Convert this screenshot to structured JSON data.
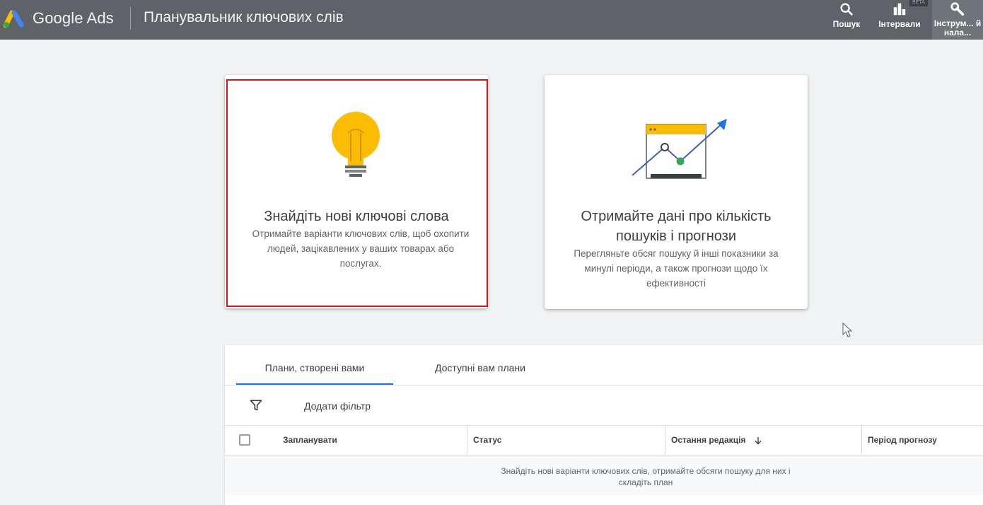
{
  "header": {
    "brand": "Google Ads",
    "title": "Планувальник ключових слів",
    "tools": {
      "search": "Пошук",
      "intervals": "Інтервали",
      "intervals_badge": "BETA",
      "settings": "Інструм... й нала..."
    }
  },
  "cards": {
    "find": {
      "title": "Знайдіть нові ключові слова",
      "description": "Отримайте варіанти ключових слів, щоб охопити людей, зацікавлених у ваших товарах або послугах."
    },
    "forecast": {
      "title": "Отримайте дані про кількість пошуків і прогнози",
      "description": "Перегляньте обсяг пошуку й інші показники за минулі періоди, а також прогнози щодо їх ефективності"
    }
  },
  "plans": {
    "tabs": [
      "Плани, створені вами",
      "Доступні вам плани"
    ],
    "add_filter": "Додати фільтр",
    "columns": [
      "Запланувати",
      "Статус",
      "Остання редакція",
      "Період прогнозу"
    ],
    "empty_message": "Знайдіть нові варіанти ключових слів, отримайте обсяги пошуку для них і складіть план"
  },
  "colors": {
    "header_bg": "#5f6368",
    "accent": "#1a73e8",
    "highlight": "#d6141b",
    "bulb": "#fbbc04",
    "chart_point": "#34a853"
  }
}
